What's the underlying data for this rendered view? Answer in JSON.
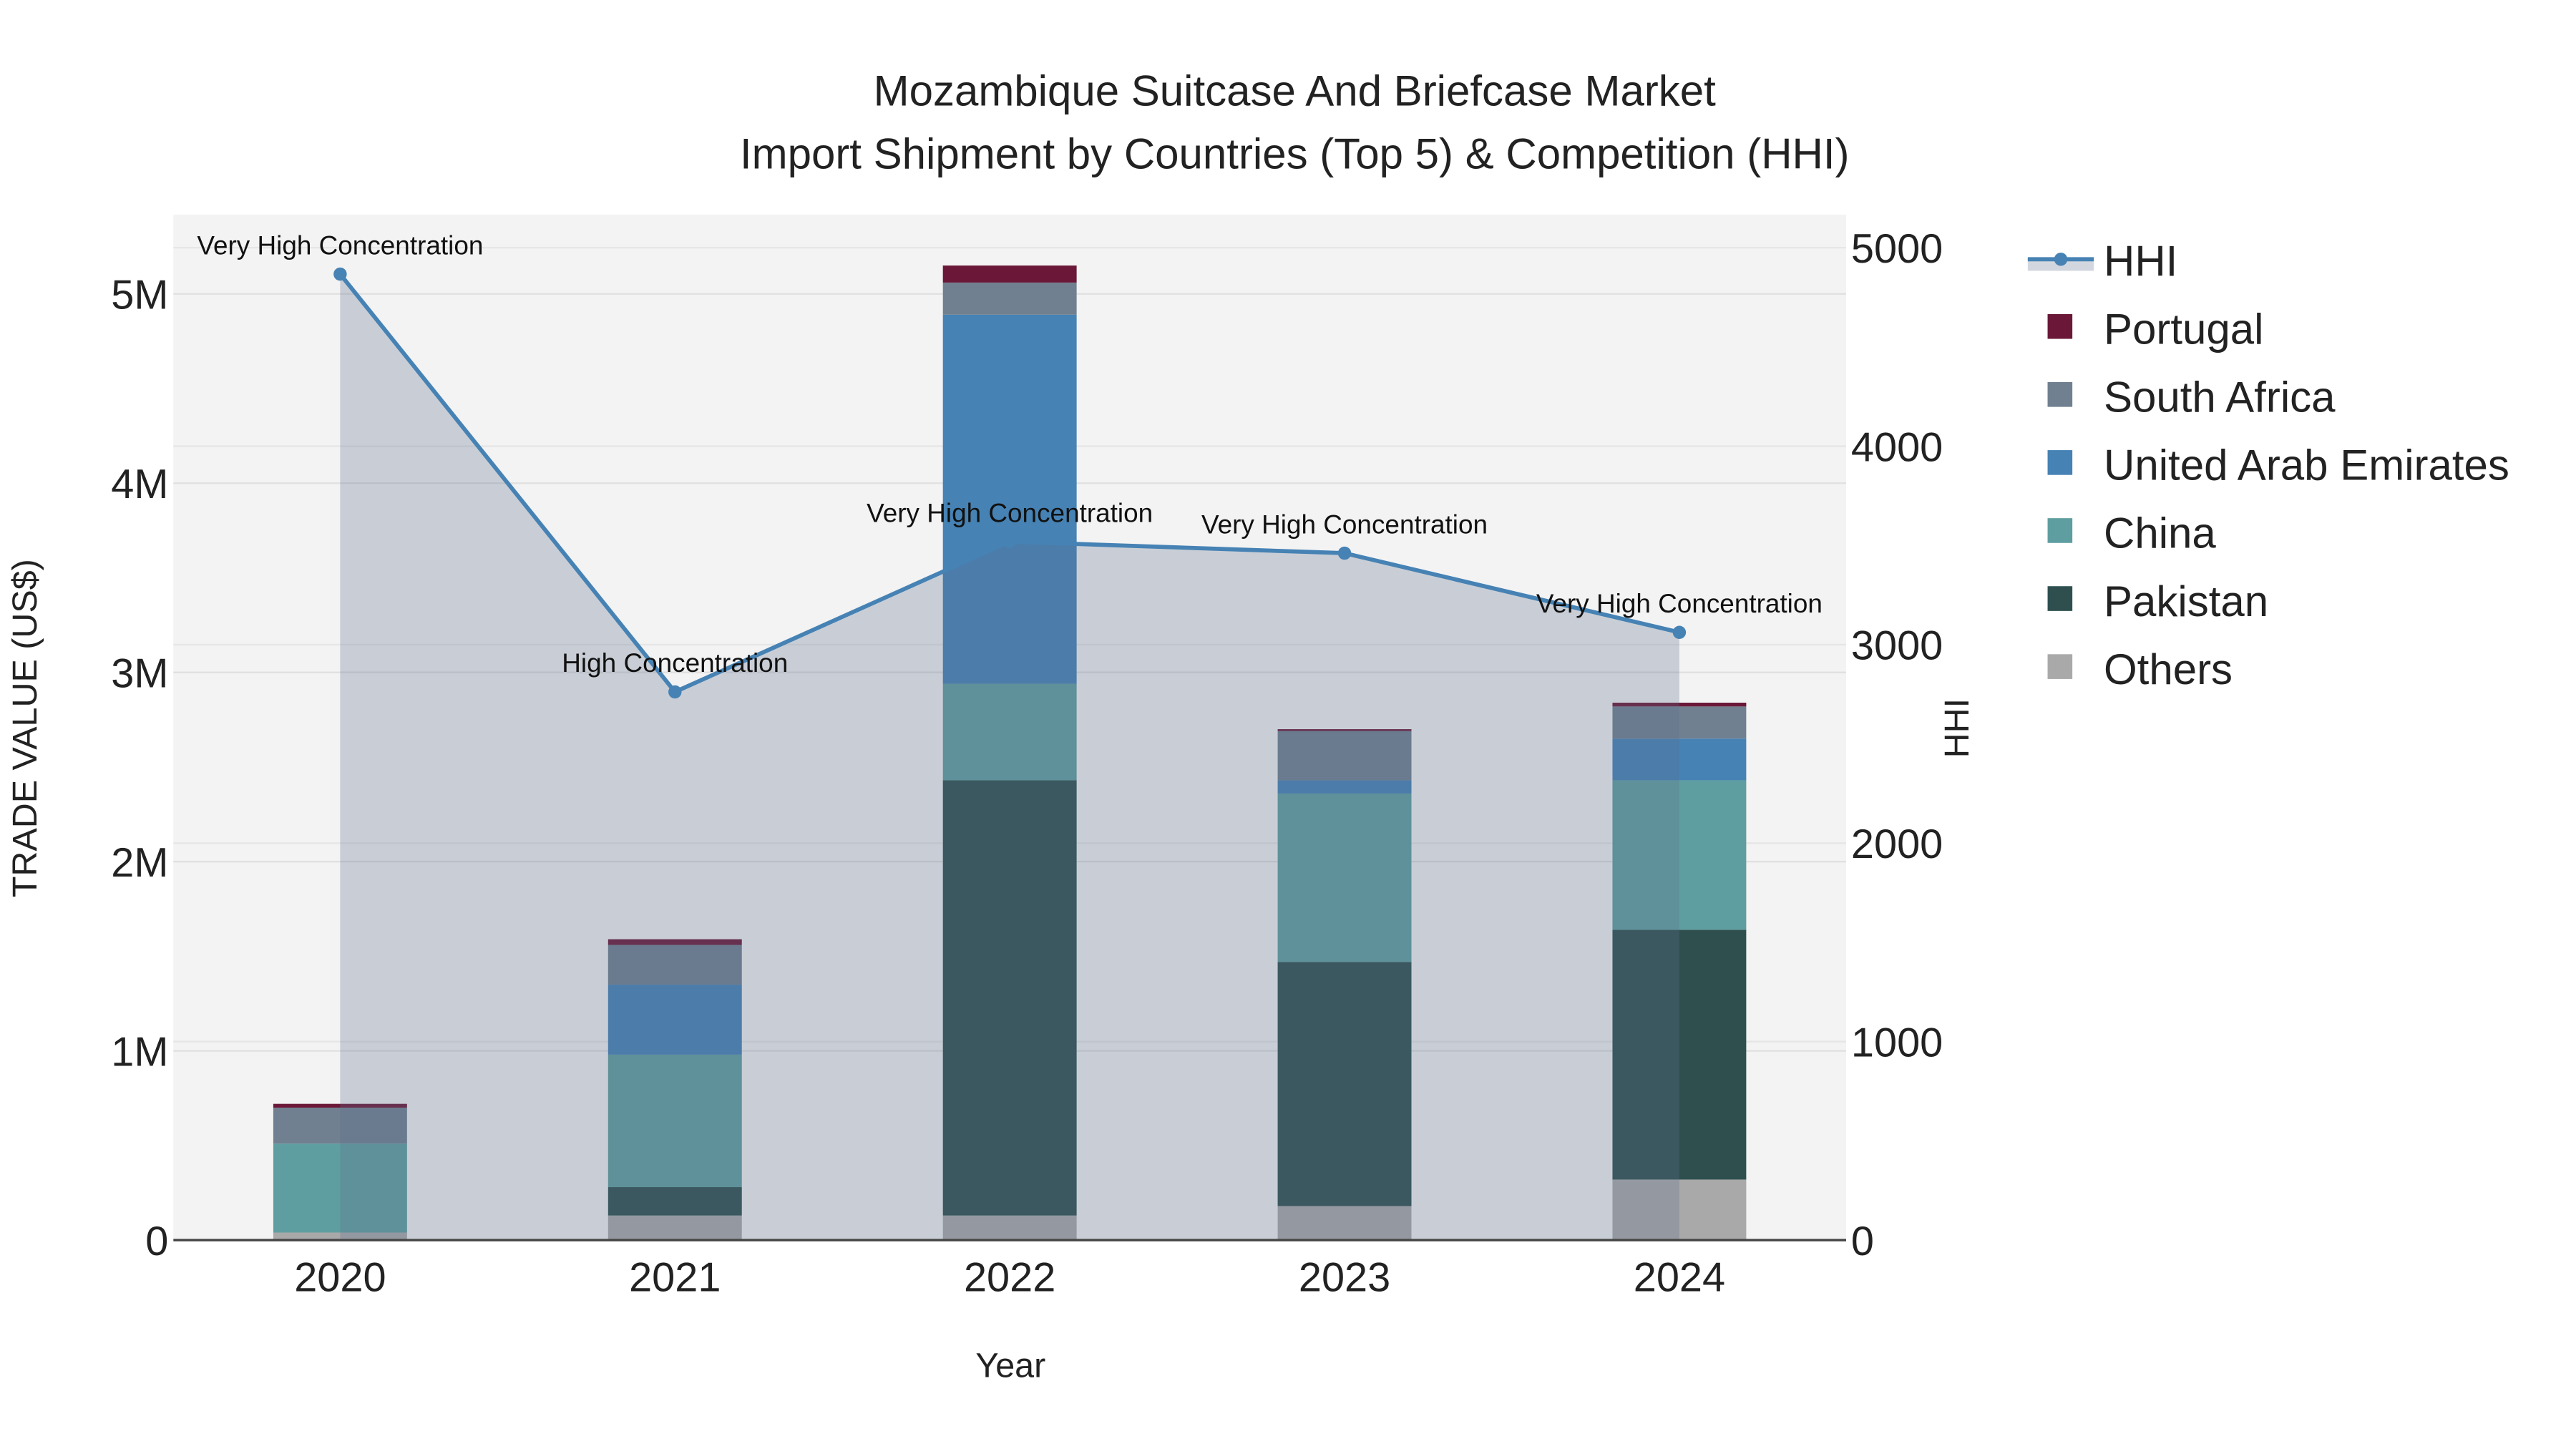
{
  "chart_data": {
    "type": "bar",
    "title": "Mozambique Suitcase And Briefcase Market",
    "subtitle": "Import Shipment by Countries (Top 5) & Competition (HHI)",
    "xlabel": "Year",
    "ylabel": "TRADE VALUE (US$)",
    "y2label": "HHI",
    "categories": [
      "2020",
      "2021",
      "2022",
      "2023",
      "2024"
    ],
    "ylim": [
      0,
      5400000
    ],
    "y2lim": [
      0,
      5150
    ],
    "yticks": [
      0,
      1000000,
      2000000,
      3000000,
      4000000,
      5000000
    ],
    "ytick_labels": [
      "0",
      "1M",
      "2M",
      "3M",
      "4M",
      "5M"
    ],
    "y2ticks": [
      0,
      1000,
      2000,
      3000,
      4000,
      5000
    ],
    "y2tick_labels": [
      "0",
      "1000",
      "2000",
      "3000",
      "4000",
      "5000"
    ],
    "stack_mode": "stacked",
    "series": [
      {
        "name": "Others",
        "color": "#a9a9a9",
        "values": [
          40000,
          130000,
          130000,
          180000,
          320000
        ]
      },
      {
        "name": "Pakistan",
        "color": "#2f4f4f",
        "values": [
          0,
          150000,
          2300000,
          1290000,
          1320000
        ]
      },
      {
        "name": "China",
        "color": "#5f9ea0",
        "values": [
          470000,
          700000,
          510000,
          890000,
          790000
        ]
      },
      {
        "name": "United Arab Emirates",
        "color": "#4682b4",
        "values": [
          0,
          370000,
          1950000,
          70000,
          220000
        ]
      },
      {
        "name": "South Africa",
        "color": "#708090",
        "values": [
          190000,
          210000,
          170000,
          260000,
          170000
        ]
      },
      {
        "name": "Portugal",
        "color": "#6b1838",
        "values": [
          20000,
          30000,
          90000,
          10000,
          20000
        ]
      }
    ],
    "hhi": {
      "name": "HHI",
      "color": "#4682b4",
      "values": [
        4867,
        2762,
        3519,
        3461,
        3062
      ],
      "annotations": [
        "Very High Concentration",
        "High Concentration",
        "Very High Concentration",
        "Very High Concentration",
        "Very High Concentration"
      ]
    },
    "legend_order": [
      "HHI",
      "Portugal",
      "South Africa",
      "United Arab Emirates",
      "China",
      "Pakistan",
      "Others"
    ],
    "legend_position": "right",
    "grid": true
  }
}
